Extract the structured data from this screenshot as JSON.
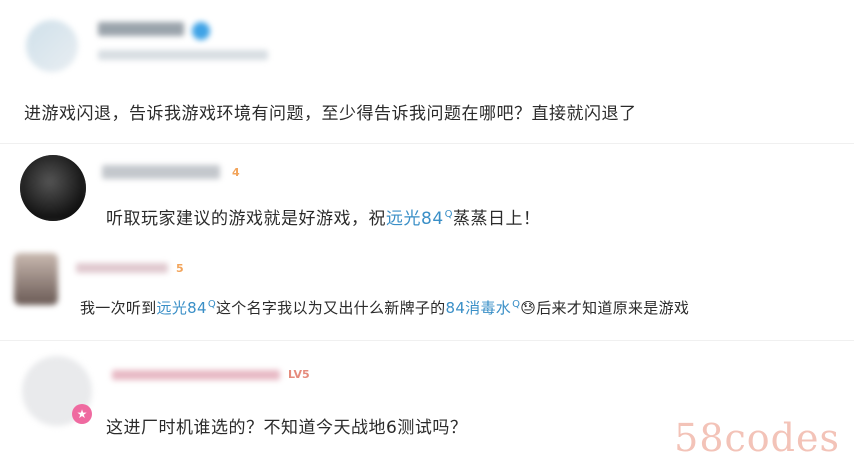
{
  "comments": [
    {
      "text": "进游戏闪退，告诉我游戏环境有问题，至少得告诉我问题在哪吧？直接就闪退了"
    },
    {
      "level_badge": "4",
      "text_before": "听取玩家建议的游戏就是好游戏，祝",
      "topic": "远光84",
      "topic_mark": "Q",
      "text_after": "蒸蒸日上！"
    },
    {
      "level_badge": "5",
      "part1": "我一次听到",
      "topic": "远光84",
      "topic_mark": "Q",
      "part2": "这个名字我以为又出什么新牌子的",
      "topic2": "84消毒水",
      "topic2_mark": "Q",
      "emoji": "😓",
      "part3": "后来才知道原来是游戏"
    },
    {
      "level_badge": "LV5",
      "text": "这进厂时机谁选的？不知道今天战地6测试吗？"
    }
  ],
  "watermark": "58codes"
}
